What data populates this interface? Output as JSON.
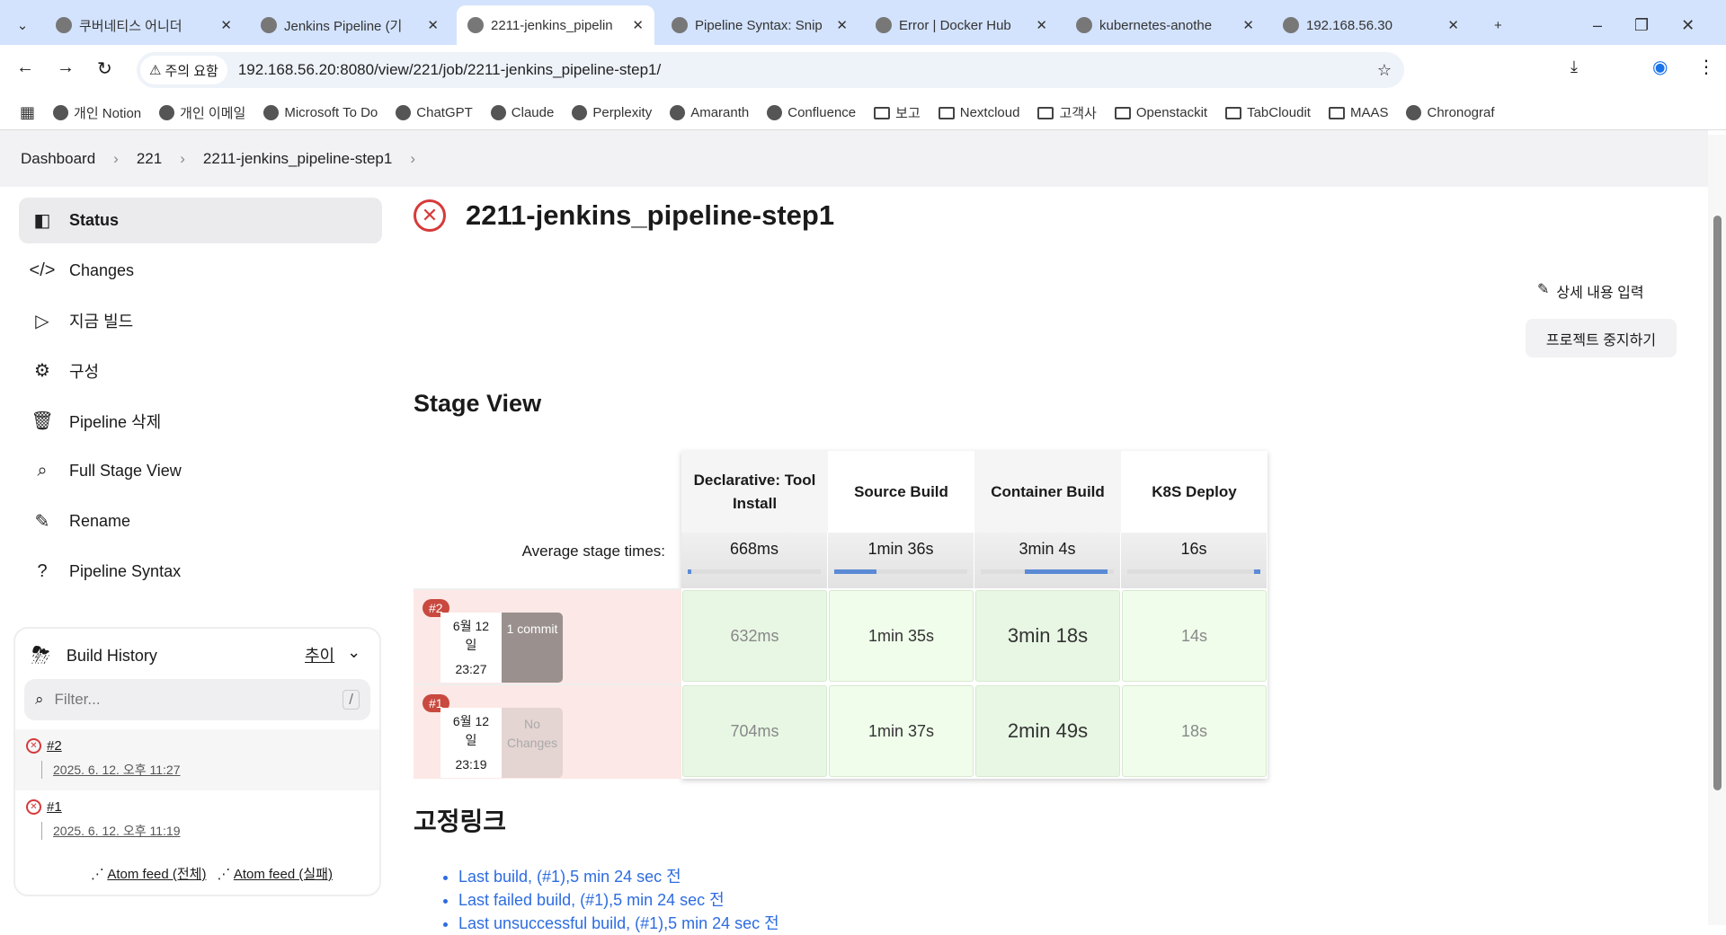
{
  "browser": {
    "tabs": [
      {
        "label": "쿠버네티스 어니더",
        "active": false
      },
      {
        "label": "Jenkins Pipeline (기",
        "active": false
      },
      {
        "label": "2211-jenkins_pipelin",
        "active": true
      },
      {
        "label": "Pipeline Syntax: Snip",
        "active": false
      },
      {
        "label": "Error | Docker Hub",
        "active": false
      },
      {
        "label": "kubernetes-anothe",
        "active": false
      },
      {
        "label": "192.168.56.30",
        "active": false
      }
    ],
    "security_label": "주의 요함",
    "url": "192.168.56.20:8080/view/221/job/2211-jenkins_pipeline-step1/",
    "bookmarks": [
      {
        "label": "개인 Notion",
        "icon": "globe"
      },
      {
        "label": "개인 이메일",
        "icon": "globe"
      },
      {
        "label": "Microsoft To Do",
        "icon": "globe"
      },
      {
        "label": "ChatGPT",
        "icon": "globe"
      },
      {
        "label": "Claude",
        "icon": "globe"
      },
      {
        "label": "Perplexity",
        "icon": "globe"
      },
      {
        "label": "Amaranth",
        "icon": "globe"
      },
      {
        "label": "Confluence",
        "icon": "globe"
      },
      {
        "label": "보고",
        "icon": "folder"
      },
      {
        "label": "Nextcloud",
        "icon": "folder"
      },
      {
        "label": "고객사",
        "icon": "folder"
      },
      {
        "label": "Openstackit",
        "icon": "folder"
      },
      {
        "label": "TabCloudit",
        "icon": "folder"
      },
      {
        "label": "MAAS",
        "icon": "folder"
      },
      {
        "label": "Chronograf",
        "icon": "globe"
      }
    ]
  },
  "breadcrumb": [
    "Dashboard",
    "221",
    "2211-jenkins_pipeline-step1"
  ],
  "sidebar": {
    "items": [
      {
        "label": "Status",
        "icon": "◧"
      },
      {
        "label": "Changes",
        "icon": "</>"
      },
      {
        "label": "지금 빌드",
        "icon": "▷"
      },
      {
        "label": "구성",
        "icon": "⚙"
      },
      {
        "label": "Pipeline 삭제",
        "icon": "🗑"
      },
      {
        "label": "Full Stage View",
        "icon": "⌕"
      },
      {
        "label": "Rename",
        "icon": "✎"
      },
      {
        "label": "Pipeline Syntax",
        "icon": "?"
      }
    ]
  },
  "build_history": {
    "title": "Build History",
    "trend": "추이",
    "filter_placeholder": "Filter...",
    "shortcut": "/",
    "builds": [
      {
        "number": "#2",
        "time": "2025. 6. 12. 오후 11:27"
      },
      {
        "number": "#1",
        "time": "2025. 6. 12. 오후 11:19"
      }
    ],
    "feeds": [
      "Atom feed (전체)",
      "Atom feed (실패)"
    ]
  },
  "job": {
    "title": "2211-jenkins_pipeline-step1",
    "edit_description": "상세 내용 입력",
    "disable_button": "프로젝트 중지하기"
  },
  "stage_view": {
    "heading": "Stage View",
    "avg_label": "Average stage times:",
    "stages": [
      {
        "name": "Declarative: Tool Install",
        "avg": "668ms",
        "bar": [
          0,
          0.02
        ]
      },
      {
        "name": "Source Build",
        "avg": "1min 36s",
        "bar": [
          0,
          0.32
        ]
      },
      {
        "name": "Container Build",
        "avg": "3min 4s",
        "bar": [
          0.33,
          0.95
        ]
      },
      {
        "name": "K8S Deploy",
        "avg": "16s",
        "bar": [
          0.95,
          1
        ]
      }
    ],
    "runs": [
      {
        "badge": "#2",
        "date": "6월 12 일",
        "time": "23:27",
        "changes": "1 commit",
        "times": [
          "632ms",
          "1min 35s",
          "3min 18s",
          "14s"
        ]
      },
      {
        "badge": "#1",
        "date": "6월 12 일",
        "time": "23:19",
        "changes": "No Changes",
        "times": [
          "704ms",
          "1min 37s",
          "2min 49s",
          "18s"
        ]
      }
    ]
  },
  "permalinks": {
    "heading": "고정링크",
    "links": [
      "Last build, (#1),5 min 24 sec 전",
      "Last failed build, (#1),5 min 24 sec 전",
      "Last unsuccessful build, (#1),5 min 24 sec 전"
    ]
  }
}
